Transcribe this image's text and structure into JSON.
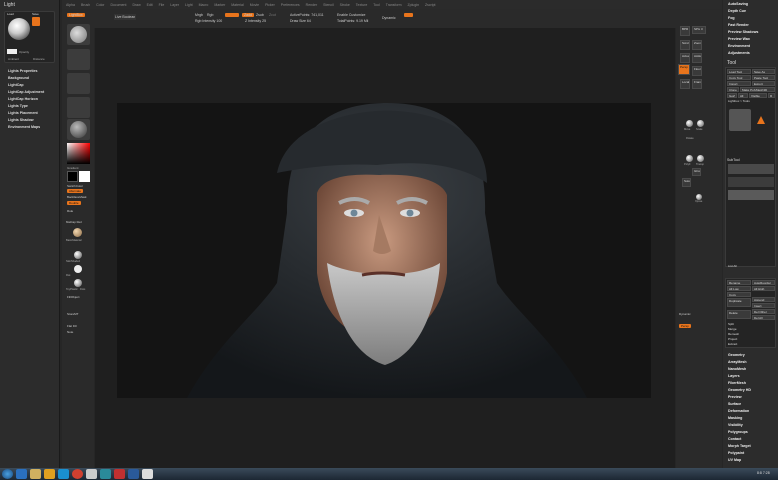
{
  "menu": [
    "Alpha",
    "Brush",
    "Color",
    "Document",
    "Draw",
    "Edit",
    "File",
    "Layer",
    "Light",
    "Macro",
    "Marker",
    "Material",
    "Movie",
    "Picker",
    "Preferences",
    "Render",
    "Stencil",
    "Stroke",
    "Texture",
    "Tool",
    "Transform",
    "Zplugin",
    "Zscript"
  ],
  "toolbar": {
    "lightbox": "LightBox",
    "livebool": "Live Boolean",
    "zadd": "Zadd",
    "zsub": "Zsub",
    "zcut": "Zcut",
    "mrgb": "Mrgb",
    "rgb": "Rgb",
    "m": "M",
    "rgb_intensity": "Rgb Intensity 100",
    "z_intensity": "Z Intensity 25",
    "active_points": "ActivePoints: 741,011",
    "total_points": "TotalPoints: 9.19 Mil",
    "draw_size": "Draw Size 64",
    "dynamic": "Dynamic",
    "enable_customize": "Enable Customize"
  },
  "left_panel": {
    "title": "Light",
    "tabs": [
      "Load",
      "Save"
    ],
    "opacity": "Opacity",
    "ambient": "Ambient",
    "distance": "Distance",
    "items": [
      "Lights Properties",
      "Background",
      "LightCap",
      "LightCap Adjustment",
      "LightCap Horizon",
      "Lights Type",
      "Lights Placement",
      "Lights Shadow",
      "Environment Maps"
    ]
  },
  "left_shelf": {
    "gradient": "Gradient",
    "switch_color": "SwitchColor",
    "alternate": "Alternate",
    "backface": "BackfaceMask",
    "double": "Double",
    "ruler": "Rule",
    "matcap": "MatCap Red",
    "mat_labels": [
      "BasicMaterial",
      "SkinShade4",
      "Flat",
      "ToyPlastic",
      "Dots"
    ],
    "fill": "FillObject",
    "store_mt": "StoreMT",
    "flat_fill": "Flat Fill",
    "note": "Note"
  },
  "right_panel": {
    "top_items": [
      "AutoSaving",
      "Depth Cue",
      "Fog",
      "Fast Render",
      "Preview Shadows",
      "Preview Wax",
      "Environment",
      "Adjustments"
    ],
    "tool_title": "Tool",
    "tool_buttons": [
      "Load Tool",
      "Save As",
      "Copy Tool",
      "Paste Tool",
      "Import",
      "Export",
      "Clone",
      "Make PolyMesh3D",
      "GoZ",
      "All",
      "Visible",
      "R"
    ],
    "lightbox_tools": "Lightbox > Tools",
    "subtool_title": "SubTool",
    "list_all": "List All",
    "sub_buttons": [
      "Rename",
      "AutoReorder",
      "All Low",
      "All High",
      "Copy",
      "Duplicate",
      "Append",
      "Insert",
      "Delete",
      "Del Other",
      "Del All",
      "Split",
      "Merge",
      "Remesh",
      "Project",
      "Extract"
    ],
    "bottom_items": [
      "Geometry",
      "ArrayMesh",
      "NanoMesh",
      "Layers",
      "FiberMesh",
      "Geometry HD",
      "Preview",
      "Surface",
      "Deformation",
      "Masking",
      "Visibility",
      "Polygroups",
      "Contact",
      "Morph Target",
      "Polypaint",
      "UV Map"
    ]
  },
  "right_shelf": {
    "labels": [
      "BPR",
      "SPix 3",
      "Scroll",
      "Zoom",
      "Actual",
      "AAHalf",
      "Persp",
      "Floor",
      "Local",
      "Frame",
      "Move",
      "Scale",
      "Rotate",
      "PolyF",
      "Transp",
      "Ghost",
      "Solo",
      "Xpose"
    ],
    "dynamic_label": "Dynamic",
    "persp": "Persp"
  },
  "taskbar": {
    "clock": "8:8 7:28"
  },
  "colors": {
    "accent": "#e8741c",
    "viewport": "#141414"
  }
}
